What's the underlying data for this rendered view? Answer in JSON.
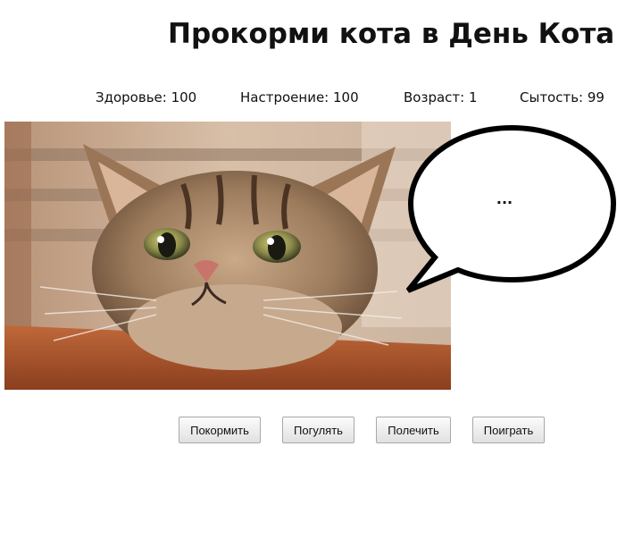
{
  "title": "Прокорми кота в День Кота!",
  "stats": {
    "health": "Здоровье: 100",
    "mood": "Настроение: 100",
    "age": "Возраст: 1",
    "satiety": "Сытость: 99"
  },
  "speech_bubble": {
    "text": "..."
  },
  "actions": {
    "feed": "Покормить",
    "walk": "Погулять",
    "heal": "Полечить",
    "play": "Поиграть"
  }
}
